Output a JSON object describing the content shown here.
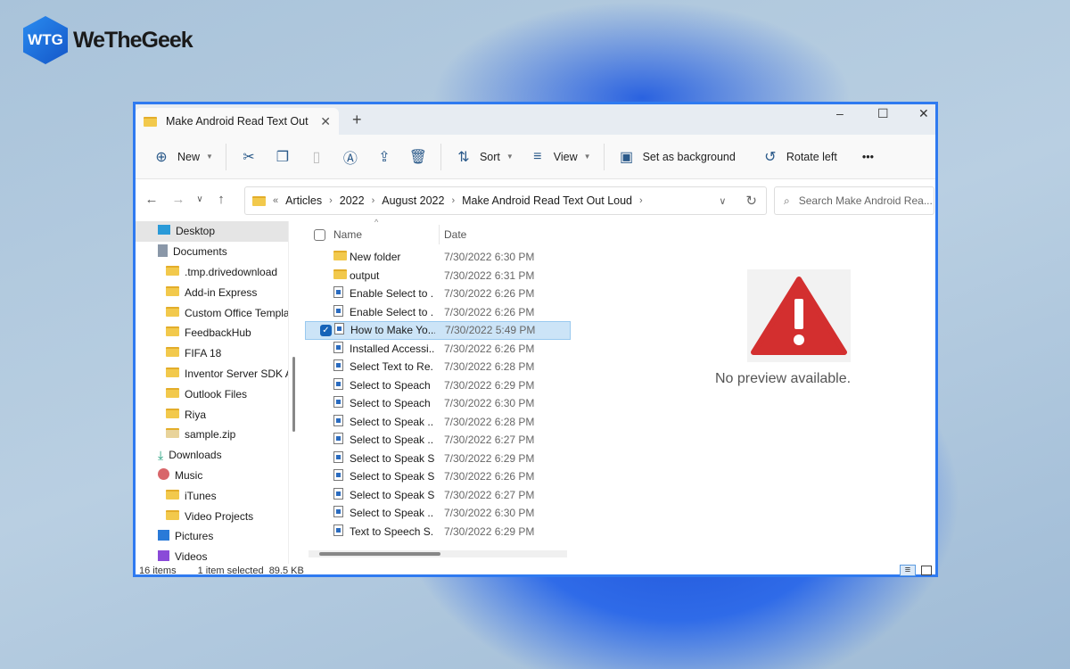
{
  "brand": {
    "name": "WeTheGeek",
    "mark": "WTG"
  },
  "window": {
    "tab_title": "Make Android Read Text Out",
    "new_tab": "+",
    "minimize": "–",
    "maximize": "☐",
    "close": "✕"
  },
  "toolbar": {
    "new": "New",
    "sort": "Sort",
    "view": "View",
    "set_bg": "Set as background",
    "rotate": "Rotate left",
    "more": "•••"
  },
  "address": {
    "overflow": "«",
    "crumbs": [
      "Articles",
      "2022",
      "August 2022",
      "Make Android Read Text Out Loud"
    ]
  },
  "search": {
    "placeholder": "Search Make Android Rea..."
  },
  "sidebar": {
    "items": [
      {
        "label": "Desktop",
        "level": 1,
        "icon": "desktop-icon"
      },
      {
        "label": "Documents",
        "level": 1,
        "icon": "documents-icon"
      },
      {
        "label": ".tmp.drivedownload",
        "level": 2,
        "icon": "folder-icon"
      },
      {
        "label": "Add-in Express",
        "level": 2,
        "icon": "folder-icon"
      },
      {
        "label": "Custom Office Template",
        "level": 2,
        "icon": "folder-icon"
      },
      {
        "label": "FeedbackHub",
        "level": 2,
        "icon": "folder-icon"
      },
      {
        "label": "FIFA 18",
        "level": 2,
        "icon": "folder-icon"
      },
      {
        "label": "Inventor Server SDK AC",
        "level": 2,
        "icon": "folder-icon"
      },
      {
        "label": "Outlook Files",
        "level": 2,
        "icon": "folder-icon"
      },
      {
        "label": "Riya",
        "level": 2,
        "icon": "folder-icon"
      },
      {
        "label": "sample.zip",
        "level": 2,
        "icon": "zip-icon"
      },
      {
        "label": "Downloads",
        "level": 1,
        "icon": "download-icon"
      },
      {
        "label": "Music",
        "level": 1,
        "icon": "music-icon"
      },
      {
        "label": "iTunes",
        "level": 2,
        "icon": "folder-icon"
      },
      {
        "label": "Video Projects",
        "level": 2,
        "icon": "folder-icon"
      },
      {
        "label": "Pictures",
        "level": 1,
        "icon": "pictures-icon"
      },
      {
        "label": "Videos",
        "level": 1,
        "icon": "videos-icon"
      }
    ]
  },
  "files": {
    "columns": {
      "name": "Name",
      "date": "Date"
    },
    "rows": [
      {
        "name": "New folder",
        "date": "7/30/2022 6:30 PM",
        "type": "folder"
      },
      {
        "name": "output",
        "date": "7/30/2022 6:31 PM",
        "type": "folder"
      },
      {
        "name": "Enable Select to ...",
        "date": "7/30/2022 6:26 PM",
        "type": "image"
      },
      {
        "name": "Enable Select to ...",
        "date": "7/30/2022 6:26 PM",
        "type": "image"
      },
      {
        "name": "How to Make Yo...",
        "date": "7/30/2022 5:49 PM",
        "type": "image",
        "selected": true
      },
      {
        "name": "Installed Accessi...",
        "date": "7/30/2022 6:26 PM",
        "type": "image"
      },
      {
        "name": "Select Text to Re...",
        "date": "7/30/2022 6:28 PM",
        "type": "image"
      },
      {
        "name": "Select to Speach ...",
        "date": "7/30/2022 6:29 PM",
        "type": "image"
      },
      {
        "name": "Select to Speach ...",
        "date": "7/30/2022 6:30 PM",
        "type": "image"
      },
      {
        "name": "Select to Speak ...",
        "date": "7/30/2022 6:28 PM",
        "type": "image"
      },
      {
        "name": "Select to Speak ...",
        "date": "7/30/2022 6:27 PM",
        "type": "image"
      },
      {
        "name": "Select to Speak S...",
        "date": "7/30/2022 6:29 PM",
        "type": "image"
      },
      {
        "name": "Select to Speak S...",
        "date": "7/30/2022 6:26 PM",
        "type": "image"
      },
      {
        "name": "Select to Speak S...",
        "date": "7/30/2022 6:27 PM",
        "type": "image"
      },
      {
        "name": "Select to Speak ...",
        "date": "7/30/2022 6:30 PM",
        "type": "image"
      },
      {
        "name": "Text to Speech S...",
        "date": "7/30/2022 6:29 PM",
        "type": "image"
      }
    ]
  },
  "preview": {
    "message": "No preview available."
  },
  "status": {
    "count": "16 items",
    "selection": "1 item selected",
    "size": "89.5 KB"
  },
  "colors": {
    "accent": "#2f7af0",
    "selection": "#cce4f7",
    "warning": "#d32f2f"
  }
}
